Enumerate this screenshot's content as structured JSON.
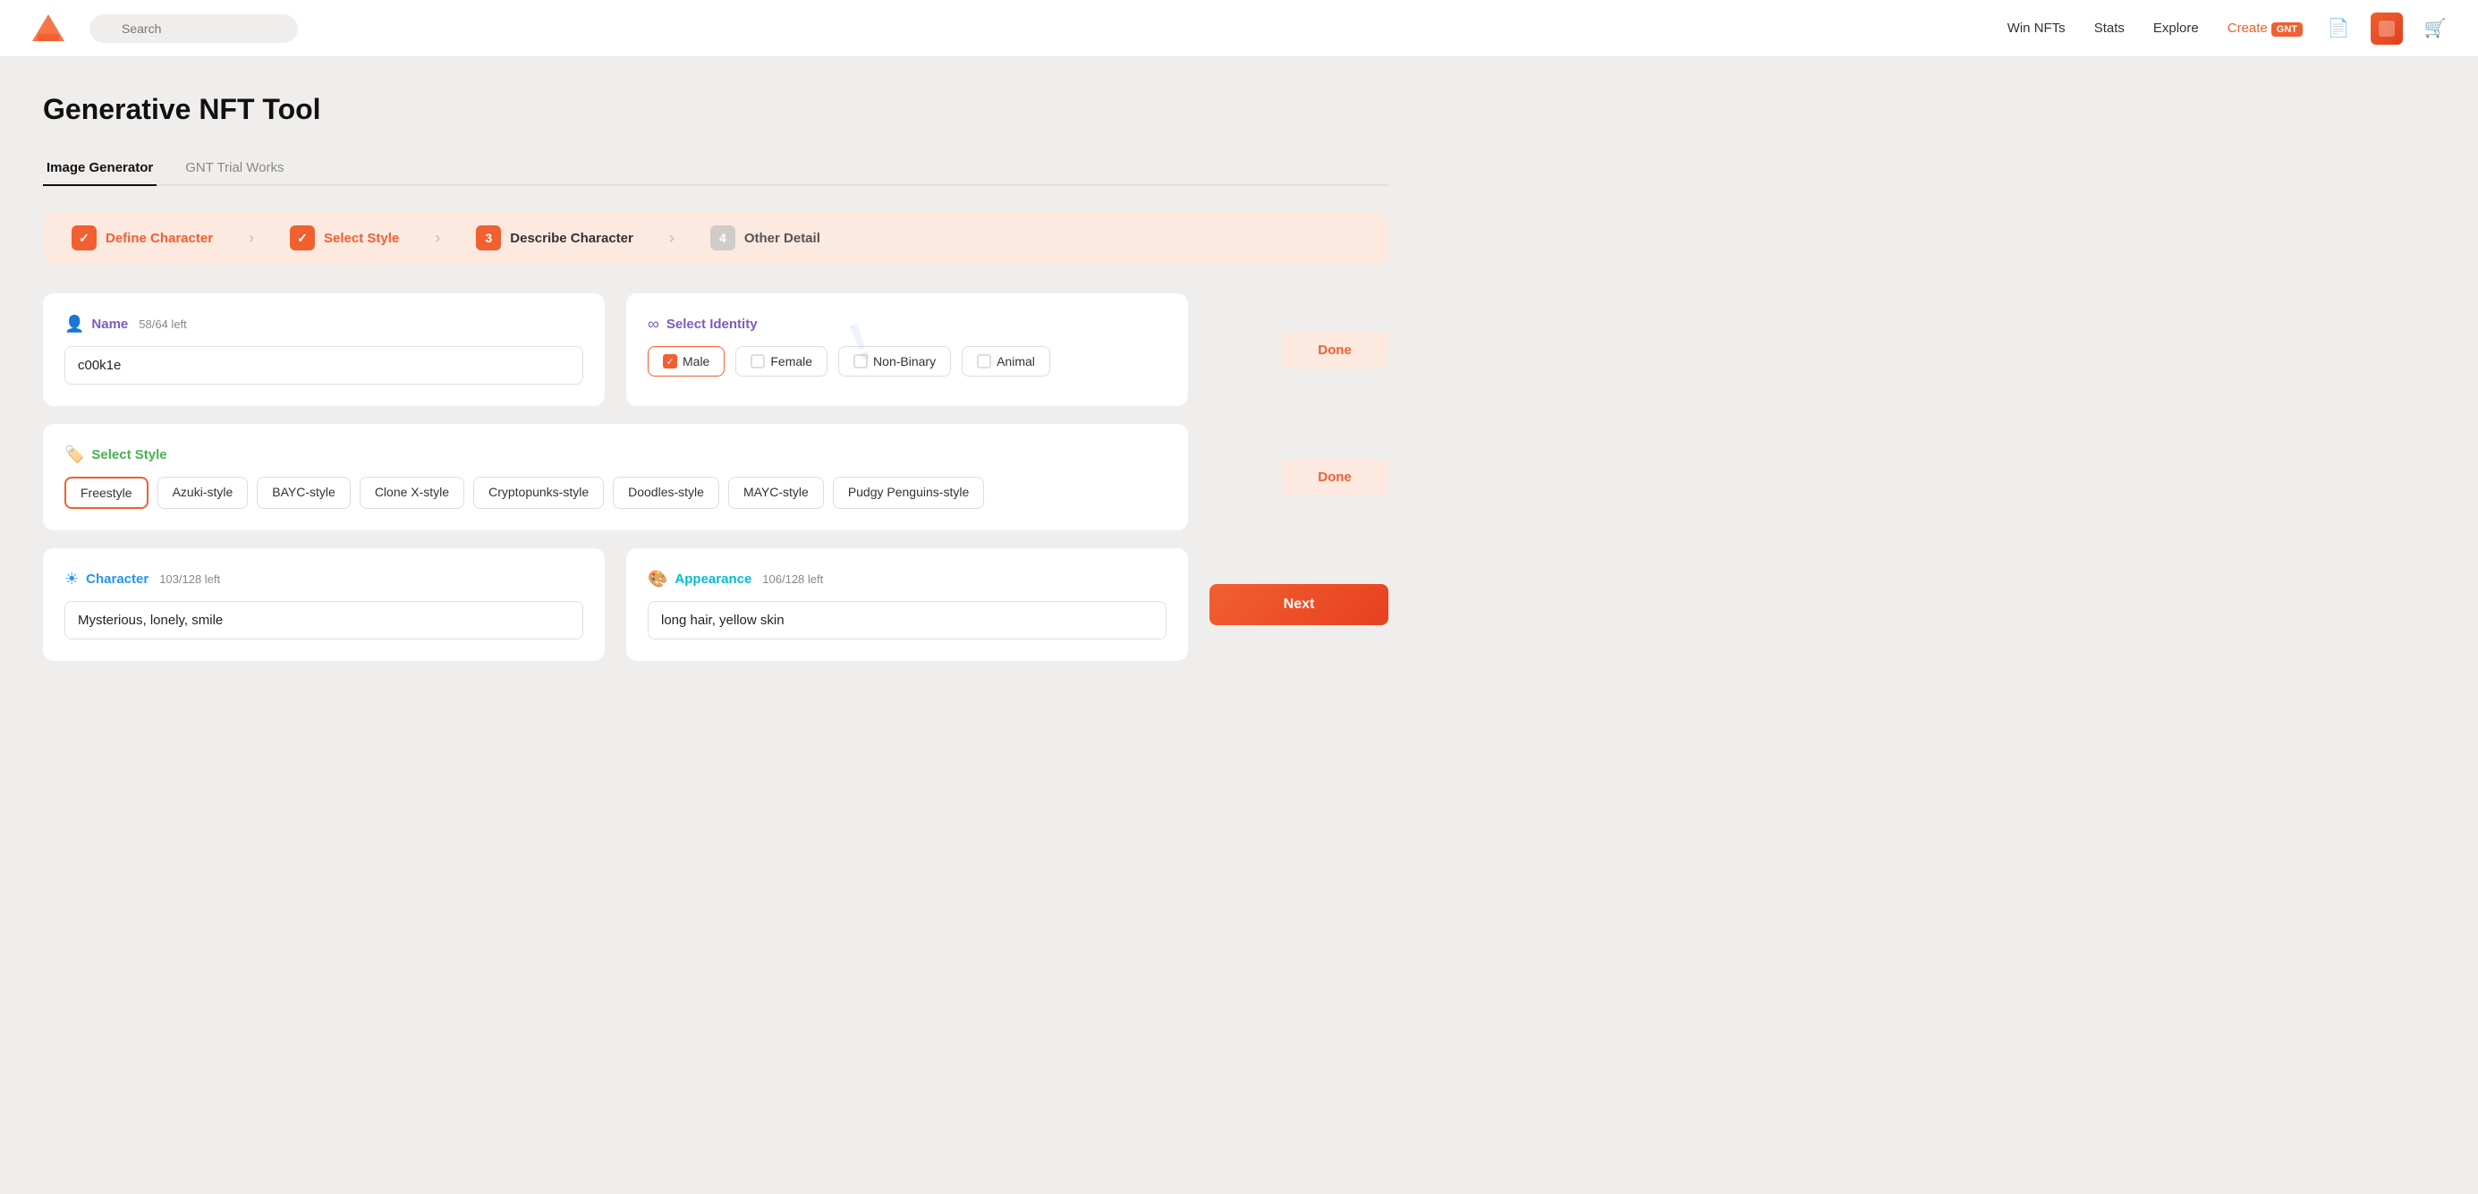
{
  "nav": {
    "links": [
      {
        "label": "Win NFTs",
        "active": false
      },
      {
        "label": "Stats",
        "active": false
      },
      {
        "label": "Explore",
        "active": false
      },
      {
        "label": "Create",
        "active": true,
        "badge": "GNT"
      }
    ],
    "search_placeholder": "Search"
  },
  "page": {
    "title": "Generative NFT Tool",
    "tabs": [
      {
        "label": "Image Generator",
        "active": true
      },
      {
        "label": "GNT Trial Works",
        "active": false
      }
    ]
  },
  "steps": [
    {
      "num": "✓",
      "label": "Define Character",
      "active": true,
      "done": true
    },
    {
      "num": "✓",
      "label": "Select Style",
      "active": true,
      "done": true
    },
    {
      "num": "3",
      "label": "Describe Character",
      "active": true,
      "done": false
    },
    {
      "num": "4",
      "label": "Other Detail",
      "active": false,
      "done": false
    }
  ],
  "name_section": {
    "title": "Name",
    "counter": "58/64 left",
    "value": "c00k1e"
  },
  "identity_section": {
    "title": "Select Identity",
    "options": [
      {
        "label": "Male",
        "checked": true
      },
      {
        "label": "Female",
        "checked": false
      },
      {
        "label": "Non-Binary",
        "checked": false
      },
      {
        "label": "Animal",
        "checked": false
      }
    ]
  },
  "style_section": {
    "title": "Select Style",
    "options": [
      {
        "label": "Freestyle",
        "selected": true
      },
      {
        "label": "Azuki-style",
        "selected": false
      },
      {
        "label": "BAYC-style",
        "selected": false
      },
      {
        "label": "Clone X-style",
        "selected": false
      },
      {
        "label": "Cryptopunks-style",
        "selected": false
      },
      {
        "label": "Doodles-style",
        "selected": false
      },
      {
        "label": "MAYC-style",
        "selected": false
      },
      {
        "label": "Pudgy Penguins-style",
        "selected": false
      }
    ]
  },
  "character_section": {
    "title": "Character",
    "counter": "103/128 left",
    "value": "Mysterious, lonely, smile"
  },
  "appearance_section": {
    "title": "Appearance",
    "counter": "106/128 left",
    "value": "long hair, yellow skin"
  },
  "buttons": {
    "done": "Done",
    "next": "Next"
  }
}
